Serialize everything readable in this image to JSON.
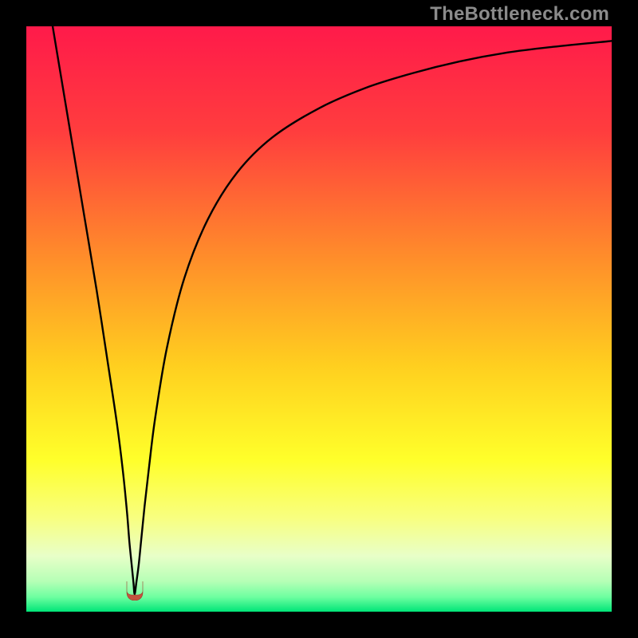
{
  "watermark": "TheBottleneck.com",
  "chart_data": {
    "type": "line",
    "title": "",
    "xlabel": "",
    "ylabel": "",
    "xlim": [
      0,
      100
    ],
    "ylim": [
      0,
      100
    ],
    "grid": false,
    "legend": false,
    "background_gradient_stops": [
      {
        "pos": 0.0,
        "color": "#ff1a4a"
      },
      {
        "pos": 0.18,
        "color": "#ff3d3e"
      },
      {
        "pos": 0.4,
        "color": "#ff8f2a"
      },
      {
        "pos": 0.58,
        "color": "#ffcf1f"
      },
      {
        "pos": 0.74,
        "color": "#ffff2a"
      },
      {
        "pos": 0.84,
        "color": "#f8ff80"
      },
      {
        "pos": 0.905,
        "color": "#e8ffc8"
      },
      {
        "pos": 0.948,
        "color": "#b6ffb6"
      },
      {
        "pos": 0.975,
        "color": "#6effa0"
      },
      {
        "pos": 1.0,
        "color": "#00e578"
      }
    ],
    "series": [
      {
        "name": "bottleneck-curve",
        "x": [
          4.5,
          6,
          8,
          10,
          12,
          14,
          15.5,
          16.5,
          17.2,
          17.6,
          18.0,
          18.3,
          18.5,
          18.8,
          19.2,
          19.6,
          20.2,
          21,
          22,
          24,
          27,
          31,
          36,
          42,
          50,
          58,
          66,
          74,
          82,
          90,
          100
        ],
        "values": [
          100,
          91,
          79,
          67,
          55,
          42,
          32,
          24,
          17,
          12,
          8,
          5,
          3,
          5,
          8,
          12,
          18,
          25,
          33,
          45,
          57,
          67,
          75,
          81,
          86,
          89.5,
          92,
          94,
          95.5,
          96.5,
          97.5
        ]
      }
    ],
    "marker": {
      "name": "optimal-point",
      "x": 18.5,
      "y": 2.2,
      "color": "#c2543f",
      "shape": "u"
    }
  }
}
